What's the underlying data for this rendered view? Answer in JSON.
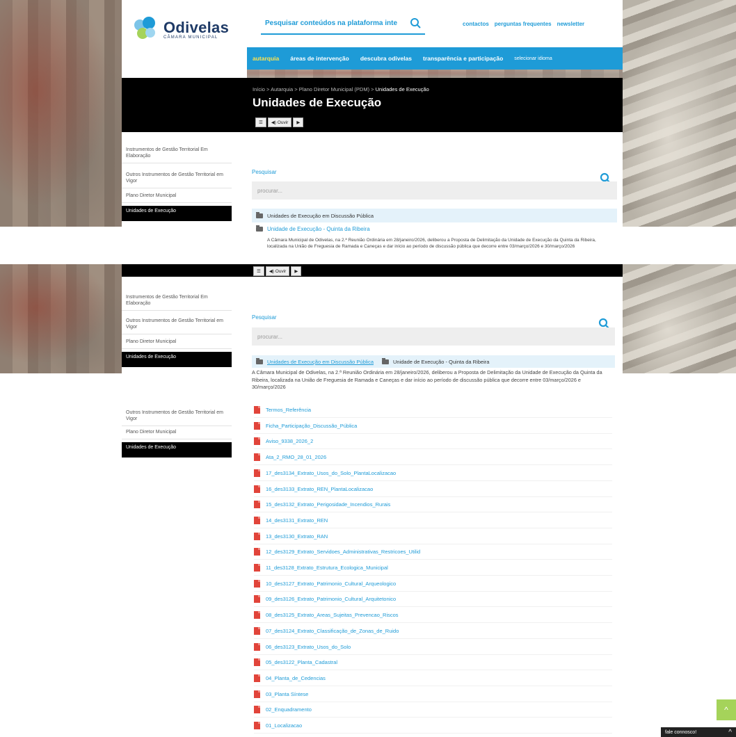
{
  "brand": {
    "name": "Odivelas",
    "sub": "CÂMARA MUNICIPAL"
  },
  "search": {
    "placeholder": "Pesquisar conteúdos na plataforma inte"
  },
  "top_links": [
    "contactos",
    "perguntas frequentes",
    "newsletter"
  ],
  "nav": [
    {
      "label": "autarquia",
      "active": true
    },
    {
      "label": "áreas de intervenção"
    },
    {
      "label": "descubra odivelas"
    },
    {
      "label": "transparência e participação"
    },
    {
      "label": "selecionar idioma"
    }
  ],
  "breadcrumb": {
    "items": [
      "Início",
      "Autarquia",
      "Plano Diretor Municipal (PDM)"
    ],
    "current": "Unidades de Execução",
    "separator": ">"
  },
  "page_title": "Unidades de Execução",
  "audio": {
    "menu": "☰",
    "listen": "◀) Ouvir",
    "play": "▶"
  },
  "sidebar": [
    {
      "label": "Instrumentos de Gestão Territorial Em Elaboração"
    },
    {
      "label": "Outros Instrumentos de Gestão Territorial em Vigor"
    },
    {
      "label": "Plano Diretor Municipal"
    },
    {
      "label": "Unidades de Execução",
      "active": true
    }
  ],
  "sidebar_short": [
    {
      "label": "Outros Instrumentos de Gestão Territorial em Vigor"
    },
    {
      "label": "Plano Diretor Municipal"
    },
    {
      "label": "Unidades de Execução",
      "active": true
    }
  ],
  "content": {
    "search_label": "Pesquisar",
    "search_placeholder": "procurar...",
    "folder": "Unidades de Execução em Discussão Pública",
    "subfolder": "Unidade de Execução - Quinta da Ribeira",
    "description": "A Câmara Municipal de Odivelas, na 2.ª Reunião Ordinária em 28/janeiro/2026, deliberou a Proposta de Delimitação da Unidade de Execução da Quinta da Ribeira, localizada na União de Freguesia de Ramada e Caneças e dar início ao período de discussão pública que decorre entre 03/março/2026 e 30/março/2026"
  },
  "files": [
    "Termos_Referência",
    "Ficha_Participação_Discussão_Pública",
    "Aviso_9338_2026_2",
    "Ata_2_RMO_28_01_2026",
    "17_des3134_Extrato_Usos_do_Solo_PlantaLocalizacao",
    "16_des3133_Extrato_REN_PlantaLocalizacao",
    "15_des3132_Extrato_Perigosidade_Incendios_Rurais",
    "14_des3131_Extrato_REN",
    "13_des3130_Extrato_RAN",
    "12_des3129_Extrato_Servidoes_Administrativas_Restricoes_Utilid",
    "11_des3128_Extrato_Estrutura_Ecologica_Municipal",
    "10_des3127_Extrato_Patrimonio_Cultural_Arqueologico",
    "09_des3126_Extrato_Patrimonio_Cultural_Arquitetonico",
    "08_des3125_Extrato_Areas_Sujeitas_Prevencao_Riscos",
    "07_des3124_Extrato_Classificação_de_Zonas_de_Ruido",
    "06_des3123_Extrato_Usos_do_Solo",
    "05_des3122_Planta_Cadastral",
    "04_Planta_de_Cedencias",
    "03_Planta Síntese",
    "02_Enquadramento",
    "01_Localizacao"
  ],
  "totop": "^",
  "bottom": {
    "label": "fale connosco!",
    "arrow": "^"
  },
  "colors": {
    "accent": "#1e9bd7",
    "nav_active": "#ffe34d",
    "pdf": "#e1443a"
  }
}
